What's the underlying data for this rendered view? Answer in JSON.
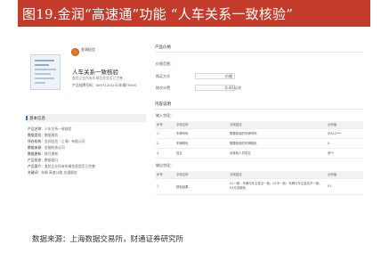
{
  "figure": {
    "title": "图19.金润“高速通”功能 “人车关系一致核验”",
    "source": "数据来源：上海数据交易所，财通证券研究所"
  },
  "product": {
    "brand": "金润征信",
    "name": "人车关系一致核验",
    "description": "查验企业所有车辆信息是否已完善",
    "code": "产品挂牌号码：00971201(示)车辆T5000"
  },
  "basic_info": {
    "title": "基本信息",
    "rows": [
      {
        "label": "产品名称：",
        "value": "人车关系一致核验"
      },
      {
        "label": "数据类别：",
        "value": "数据服务"
      },
      {
        "label": "所在机构：",
        "value": "金润征信（上海）有限公司"
      },
      {
        "label": "数据来源：",
        "value": "金融科技公司"
      },
      {
        "label": "数据更新：",
        "value": "按月更新"
      },
      {
        "label": "产品形态：",
        "value": "数据接口"
      },
      {
        "label": "产品简介：",
        "value": "查验企业所有车辆信息是否已完善"
      },
      {
        "label": "关键词：",
        "value": "车辆 高速公路 交通服务"
      }
    ]
  },
  "price": {
    "title": "产品价格",
    "section": "价格范围：",
    "rows": [
      {
        "label": "购买方式",
        "value": "价格"
      },
      {
        "label": "按次计费",
        "value": "0.40元/次"
      }
    ]
  },
  "content": {
    "title": "内容说明",
    "input": {
      "title": "输入字段：",
      "headers": [
        "序号",
        "字段名称",
        "字段描述",
        "示例值"
      ],
      "rows": [
        [
          "1",
          "车牌号码",
          "需要核验的车牌号码",
          "沪A12***"
        ],
        [
          "2",
          "车牌颜色",
          "需要核验的车牌颜色",
          "0"
        ],
        [
          "3",
          "姓名",
          "待核验人员姓名",
          "张**"
        ]
      ]
    },
    "output": {
      "title": "输出字段：",
      "headers": [
        "序号",
        "字段名称",
        "字段描述",
        "示例值"
      ],
      "rows": [
        [
          "1",
          "核验结果",
          "01一致：车牌与车主姓名一致；02不一致：车牌与车主姓名不一致；03无法核验",
          "01"
        ]
      ]
    }
  }
}
